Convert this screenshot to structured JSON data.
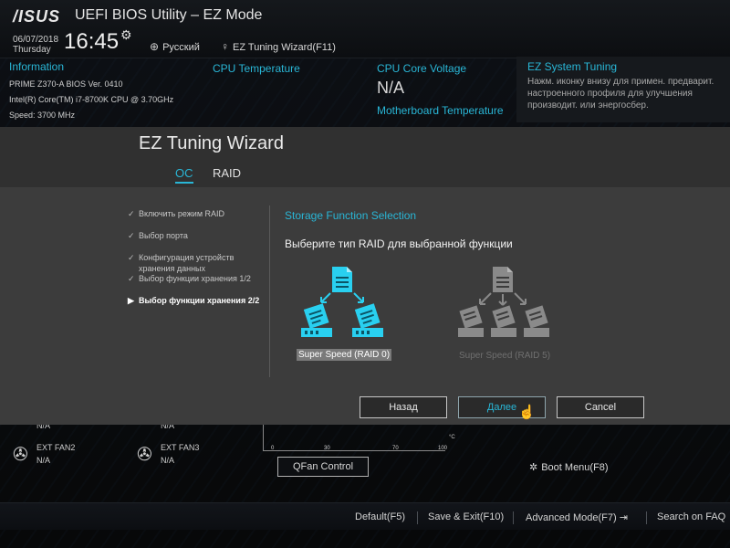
{
  "header": {
    "logo": "/ISUS",
    "title": "UEFI BIOS Utility – EZ Mode",
    "date": "06/07/2018",
    "day": "Thursday",
    "time": "16:45",
    "language": "Русский",
    "ez_wizard": "EZ Tuning Wizard(F11)"
  },
  "information": {
    "title": "Information",
    "board": "PRIME Z370-A   BIOS Ver. 0410",
    "cpu": "Intel(R) Core(TM) i7-8700K CPU @ 3.70GHz",
    "speed": "Speed: 3700 MHz"
  },
  "cpu_temperature": {
    "title": "CPU Temperature"
  },
  "cpu_voltage": {
    "title": "CPU Core Voltage",
    "value": "N/A"
  },
  "mb_temperature": {
    "title": "Motherboard Temperature"
  },
  "ez_system_tuning": {
    "title": "EZ System Tuning",
    "description": "Нажм. иконку внизу для примен. предварит. настроенного профиля для улучшения производит. или энергосбер."
  },
  "dialog": {
    "title": "EZ Tuning Wizard",
    "tabs": [
      "OC",
      "RAID"
    ],
    "steps": [
      {
        "label": "Включить режим RAID",
        "done": true
      },
      {
        "label": "Выбор порта",
        "done": true
      },
      {
        "label": "Конфигурация устройств хранения данных",
        "done": true
      },
      {
        "label": "Выбор функции хранения 1/2",
        "done": true
      },
      {
        "label": "Выбор функции хранения 2/2",
        "done": false,
        "active": true
      }
    ],
    "section_title": "Storage Function Selection",
    "prompt": "Выберите тип RAID для выбранной функции",
    "options": [
      {
        "label": "Super Speed (RAID 0)",
        "selected": true
      },
      {
        "label": "Super Speed (RAID 5)",
        "selected": false
      }
    ],
    "buttons": {
      "back": "Назад",
      "next": "Далее",
      "cancel": "Cancel"
    }
  },
  "fans": [
    {
      "name": "",
      "value": "N/A"
    },
    {
      "name": "",
      "value": "N/A"
    },
    {
      "name": "EXT FAN2",
      "value": "N/A"
    },
    {
      "name": "EXT FAN3",
      "value": "N/A"
    }
  ],
  "fan_chart": {
    "ticks": [
      "0",
      "30",
      "70",
      "100"
    ],
    "unit": "°C"
  },
  "qfan_button": "QFan Control",
  "boot_menu": "Boot Menu(F8)",
  "footer": [
    "Default(F5)",
    "Save & Exit(F10)",
    "Advanced Mode(F7)",
    "Search on FAQ"
  ],
  "colors": {
    "accent": "#29b6d6",
    "dialog_bg": "#3c3c3c",
    "header_bg": "#303030"
  }
}
